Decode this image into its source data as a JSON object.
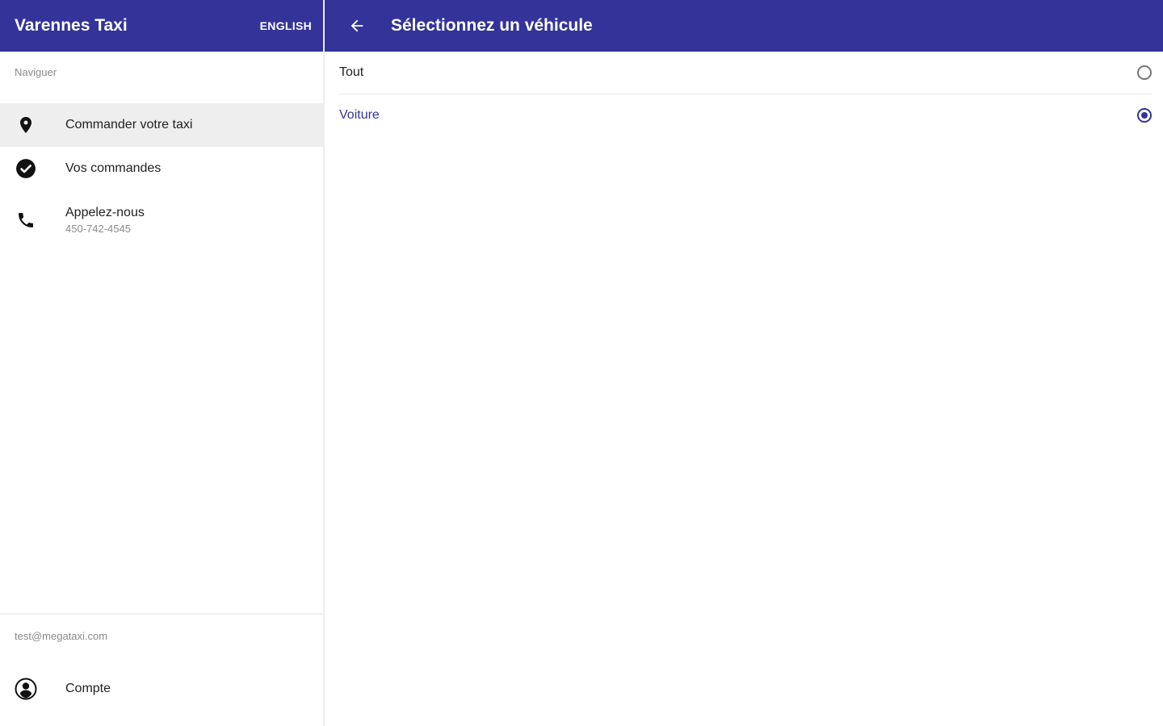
{
  "colors": {
    "primary": "#333399",
    "active_background": "#eeeeee",
    "secondary_text": "#8a8a8a"
  },
  "sidebar": {
    "brand": "Varennes Taxi",
    "language_button": "ENGLISH",
    "section_label": "Naviguer",
    "items": [
      {
        "label": "Commander votre taxi",
        "icon": "location-pin-icon",
        "active": true
      },
      {
        "label": "Vos commandes",
        "icon": "check-circle-icon",
        "active": false
      },
      {
        "label": "Appelez-nous",
        "sublabel": "450-742-4545",
        "icon": "phone-icon",
        "active": false
      }
    ],
    "account_email": "test@megataxi.com",
    "account_label": "Compte",
    "account_icon": "account-circle-icon"
  },
  "main": {
    "back_icon": "arrow-back-icon",
    "title": "Sélectionnez un véhicule",
    "options": [
      {
        "label": "Tout",
        "selected": false
      },
      {
        "label": "Voiture",
        "selected": true
      }
    ]
  }
}
